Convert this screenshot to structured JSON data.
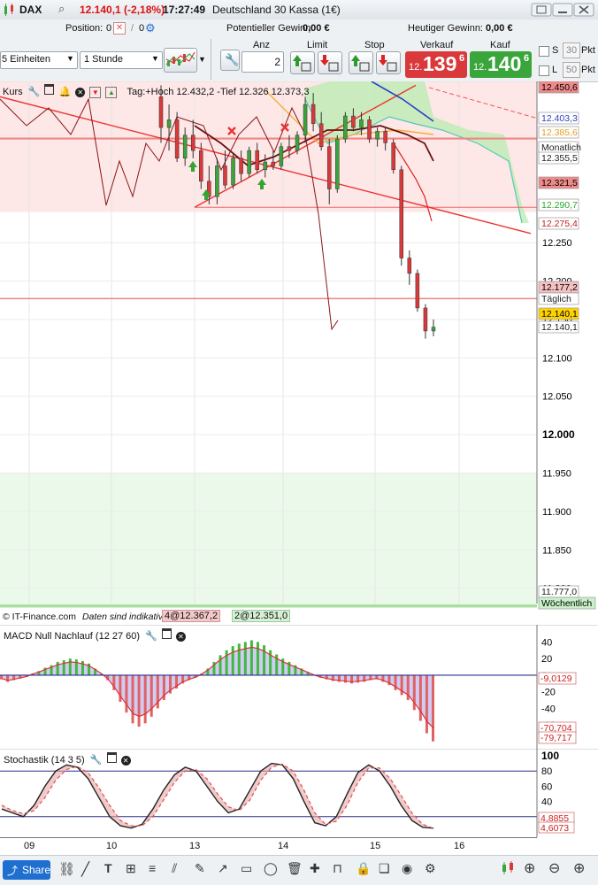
{
  "header": {
    "instrument": "DAX",
    "quote": "12.140,1 (-2,18%)",
    "time": "17:27:49",
    "market": "Deutschland 30 Kassa (1€)"
  },
  "position_bar": {
    "position_label": "Position:",
    "position_value": "0",
    "pending_value": "0",
    "potential_label": "Potentieller Gewinn:",
    "potential_value": "0,00 €",
    "today_label": "Heutiger Gewinn:",
    "today_value": "0,00 €"
  },
  "order_bar": {
    "units_select": "5 Einheiten",
    "timeframe_select": "1 Stunde",
    "anz_label": "Anz",
    "anz_value": "2",
    "limit_label": "Limit",
    "stop_label": "Stop",
    "sell_label": "Verkauf",
    "buy_label": "Kauf",
    "sell_prefix": "12.",
    "sell_big": "139",
    "sell_sup": "6",
    "buy_prefix": "12.",
    "buy_big": "140",
    "buy_sup": "6",
    "s_label": "S",
    "s_value": "30",
    "l_label": "L",
    "l_value": "50",
    "pkt_label": "Pkt",
    "sell_color": "#d9393a",
    "buy_color": "#3aa53a"
  },
  "main_chart": {
    "legend_kurs": "Kurs",
    "legend_info": "Tag:+Hoch 12.432,2 -Tief 12.326 12.373,3",
    "footer_source": "© IT-Finance.com",
    "footer_note": "Daten sind indikativ",
    "order_tag_1": "4@12.367,2",
    "order_tag_2": "2@12.351,0",
    "y_ticks": [
      "12.250",
      "12.200",
      "12.150",
      "12.100",
      "12.050",
      "12.000",
      "11.950",
      "11.900",
      "11.850",
      "11.800"
    ],
    "tags": [
      {
        "text": "12.450,6",
        "bg": "#f08a8a",
        "fg": "#000"
      },
      {
        "text": "12.403,3",
        "bg": "#ffffff",
        "fg": "#2a3fc8"
      },
      {
        "text": "12.385,6",
        "bg": "#ffffff",
        "fg": "#e0a020"
      },
      {
        "text": "Monatlich",
        "bg": "#ffffff",
        "fg": "#222"
      },
      {
        "text": "12.355,5",
        "bg": "#ffffff",
        "fg": "#222"
      },
      {
        "text": "12.321,5",
        "bg": "#f08a8a",
        "fg": "#000"
      },
      {
        "text": "12.290,7",
        "bg": "#ffffff",
        "fg": "#2aa52a"
      },
      {
        "text": "12.275,4",
        "bg": "#ffffff",
        "fg": "#c02020"
      },
      {
        "text": "12.177,2",
        "bg": "#f6c0c0",
        "fg": "#000"
      },
      {
        "text": "Täglich",
        "bg": "#ffffff",
        "fg": "#222"
      },
      {
        "text": "12.140,1",
        "bg": "#ffd200",
        "fg": "#000"
      },
      {
        "text": "12.140,1",
        "bg": "#ffffff",
        "fg": "#222"
      },
      {
        "text": "11.777,0",
        "bg": "#ffffff",
        "fg": "#222"
      },
      {
        "text": "Wöchentlich",
        "bg": "#c9f0c9",
        "fg": "#000"
      }
    ]
  },
  "macd": {
    "title": "MACD Null Nachlauf (12 27 60)",
    "y_ticks": [
      "40",
      "20",
      "0",
      "-20",
      "-40",
      "-60"
    ],
    "tag_1": "-9,0129",
    "tag_2": "-70,704",
    "tag_3": "-79,717"
  },
  "stochastic": {
    "title": "Stochastik (14 3 5)",
    "y_ticks": [
      "100",
      "80",
      "60",
      "40"
    ],
    "tag_1": "4,8855",
    "tag_2": "4,6073"
  },
  "x_axis": {
    "labels": [
      "09",
      "10",
      "13",
      "14",
      "15",
      "16"
    ]
  },
  "bottom_bar": {
    "share_label": "Share"
  },
  "chart_data": [
    {
      "type": "candlestick",
      "title": "DAX",
      "subtitle": "Deutschland 30 Kassa (1€)",
      "xlabel": "",
      "ylabel": "",
      "x_ticks": [
        "09",
        "10",
        "13",
        "14",
        "15",
        "16"
      ],
      "ylim": [
        11780,
        12460
      ],
      "y_scale": "linear",
      "grid": true,
      "legend": "top-left",
      "ohlc": [
        {
          "x": "12",
          "o": 12440,
          "h": 12455,
          "l": 12380,
          "c": 12400
        },
        {
          "x": "12",
          "o": 12400,
          "h": 12430,
          "l": 12370,
          "c": 12410
        },
        {
          "x": "12",
          "o": 12410,
          "h": 12420,
          "l": 12355,
          "c": 12360
        },
        {
          "x": "12",
          "o": 12360,
          "h": 12400,
          "l": 12350,
          "c": 12390
        },
        {
          "x": "12",
          "o": 12390,
          "h": 12410,
          "l": 12360,
          "c": 12370
        },
        {
          "x": "12",
          "o": 12370,
          "h": 12380,
          "l": 12320,
          "c": 12330
        },
        {
          "x": "13",
          "o": 12330,
          "h": 12350,
          "l": 12300,
          "c": 12310
        },
        {
          "x": "13",
          "o": 12310,
          "h": 12360,
          "l": 12300,
          "c": 12350
        },
        {
          "x": "13",
          "o": 12350,
          "h": 12370,
          "l": 12320,
          "c": 12325
        },
        {
          "x": "13",
          "o": 12325,
          "h": 12365,
          "l": 12320,
          "c": 12360
        },
        {
          "x": "13",
          "o": 12360,
          "h": 12370,
          "l": 12330,
          "c": 12340
        },
        {
          "x": "13",
          "o": 12340,
          "h": 12375,
          "l": 12335,
          "c": 12370
        },
        {
          "x": "13",
          "o": 12370,
          "h": 12380,
          "l": 12340,
          "c": 12345
        },
        {
          "x": "13",
          "o": 12345,
          "h": 12365,
          "l": 12335,
          "c": 12355
        },
        {
          "x": "13",
          "o": 12355,
          "h": 12370,
          "l": 12345,
          "c": 12350
        },
        {
          "x": "14",
          "o": 12350,
          "h": 12380,
          "l": 12345,
          "c": 12375
        },
        {
          "x": "14",
          "o": 12375,
          "h": 12390,
          "l": 12360,
          "c": 12370
        },
        {
          "x": "14",
          "o": 12370,
          "h": 12395,
          "l": 12365,
          "c": 12390
        },
        {
          "x": "14",
          "o": 12390,
          "h": 12440,
          "l": 12380,
          "c": 12430
        },
        {
          "x": "14",
          "o": 12430,
          "h": 12445,
          "l": 12395,
          "c": 12405
        },
        {
          "x": "14",
          "o": 12405,
          "h": 12420,
          "l": 12370,
          "c": 12375
        },
        {
          "x": "14",
          "o": 12375,
          "h": 12385,
          "l": 12300,
          "c": 12320
        },
        {
          "x": "14",
          "o": 12320,
          "h": 12390,
          "l": 12315,
          "c": 12385
        },
        {
          "x": "14",
          "o": 12385,
          "h": 12420,
          "l": 12380,
          "c": 12415
        },
        {
          "x": "15",
          "o": 12415,
          "h": 12425,
          "l": 12395,
          "c": 12400
        },
        {
          "x": "15",
          "o": 12400,
          "h": 12420,
          "l": 12390,
          "c": 12410
        },
        {
          "x": "15",
          "o": 12410,
          "h": 12415,
          "l": 12380,
          "c": 12385
        },
        {
          "x": "15",
          "o": 12385,
          "h": 12400,
          "l": 12375,
          "c": 12395
        },
        {
          "x": "15",
          "o": 12395,
          "h": 12400,
          "l": 12370,
          "c": 12380
        },
        {
          "x": "15",
          "o": 12380,
          "h": 12385,
          "l": 12340,
          "c": 12345
        },
        {
          "x": "15",
          "o": 12345,
          "h": 12350,
          "l": 12220,
          "c": 12230
        },
        {
          "x": "15",
          "o": 12230,
          "h": 12240,
          "l": 12195,
          "c": 12210
        },
        {
          "x": "15",
          "o": 12210,
          "h": 12215,
          "l": 12160,
          "c": 12165
        },
        {
          "x": "15",
          "o": 12165,
          "h": 12170,
          "l": 12125,
          "c": 12135
        },
        {
          "x": "15",
          "o": 12135,
          "h": 12150,
          "l": 12128,
          "c": 12140
        }
      ],
      "levels": [
        {
          "name": "Monatlich",
          "value": 12385.6
        },
        {
          "name": "Täglich",
          "value": 12177.2
        },
        {
          "name": "Wöchentlich",
          "value": 11777.0
        }
      ],
      "last": 12140.1
    },
    {
      "type": "bar",
      "title": "MACD Null Nachlauf (12 27 60)",
      "ylim": [
        -80,
        50
      ],
      "values": [
        -5,
        -8,
        -6,
        -4,
        -2,
        2,
        5,
        9,
        12,
        16,
        18,
        20,
        19,
        17,
        14,
        8,
        2,
        -6,
        -18,
        -32,
        -45,
        -58,
        -62,
        -58,
        -50,
        -40,
        -30,
        -22,
        -16,
        -10,
        -6,
        -3,
        2,
        8,
        16,
        24,
        30,
        35,
        38,
        40,
        42,
        40,
        36,
        30,
        25,
        20,
        16,
        12,
        8,
        4,
        0,
        -3,
        -5,
        -7,
        -8,
        -9,
        -10,
        -9,
        -8,
        -6,
        -5,
        -8,
        -12,
        -18,
        -24,
        -30,
        -42,
        -55,
        -70,
        -79.7
      ],
      "last_values": [
        -9.0129,
        -70.704,
        -79.717
      ]
    },
    {
      "type": "line",
      "title": "Stochastik (14 3 5)",
      "ylim": [
        0,
        100
      ],
      "series": [
        {
          "name": "%K",
          "values": [
            30,
            25,
            20,
            35,
            60,
            80,
            88,
            85,
            70,
            45,
            20,
            8,
            5,
            10,
            30,
            55,
            75,
            85,
            80,
            60,
            40,
            25,
            30,
            55,
            80,
            90,
            88,
            70,
            40,
            12,
            8,
            20,
            50,
            78,
            88,
            80,
            60,
            35,
            15,
            6,
            4.9
          ]
        },
        {
          "name": "%D",
          "values": [
            35,
            28,
            24,
            28,
            45,
            68,
            82,
            86,
            78,
            58,
            35,
            15,
            8,
            8,
            20,
            42,
            65,
            80,
            82,
            70,
            50,
            33,
            28,
            42,
            68,
            85,
            89,
            80,
            55,
            25,
            10,
            14,
            35,
            65,
            84,
            84,
            70,
            48,
            25,
            10,
            4.6
          ]
        }
      ],
      "last_values": [
        4.8855,
        4.6073
      ]
    }
  ]
}
